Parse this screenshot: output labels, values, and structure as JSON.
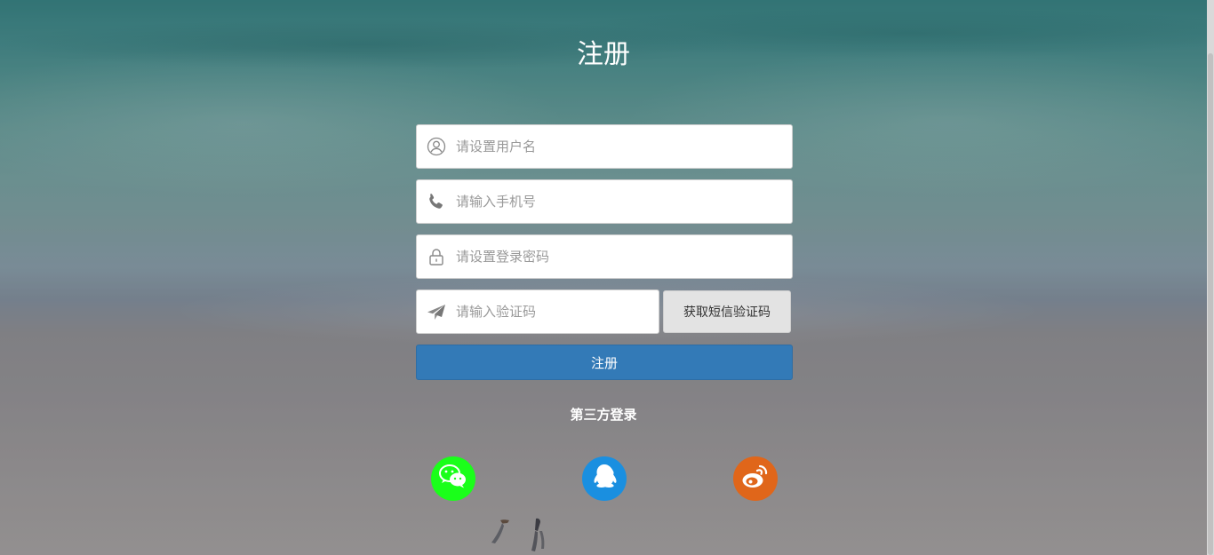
{
  "page": {
    "title": "注册"
  },
  "form": {
    "username": {
      "placeholder": "请设置用户名",
      "icon": "user-icon"
    },
    "phone": {
      "placeholder": "请输入手机号",
      "icon": "phone-icon"
    },
    "password": {
      "placeholder": "请设置登录密码",
      "icon": "lock-icon"
    },
    "code": {
      "placeholder": "请输入验证码",
      "icon": "paper-plane-icon"
    },
    "sms_button_label": "获取短信验证码",
    "submit_label": "注册"
  },
  "third_party": {
    "title": "第三方登录",
    "providers": [
      {
        "name": "wechat",
        "icon": "wechat-icon",
        "color": "#1aff1a"
      },
      {
        "name": "qq",
        "icon": "qq-icon",
        "color": "#1a8fe0"
      },
      {
        "name": "weibo",
        "icon": "weibo-icon",
        "color": "#e0661a"
      }
    ]
  },
  "colors": {
    "primary": "#337ab7",
    "sms_button_bg": "#e3e3e3"
  }
}
